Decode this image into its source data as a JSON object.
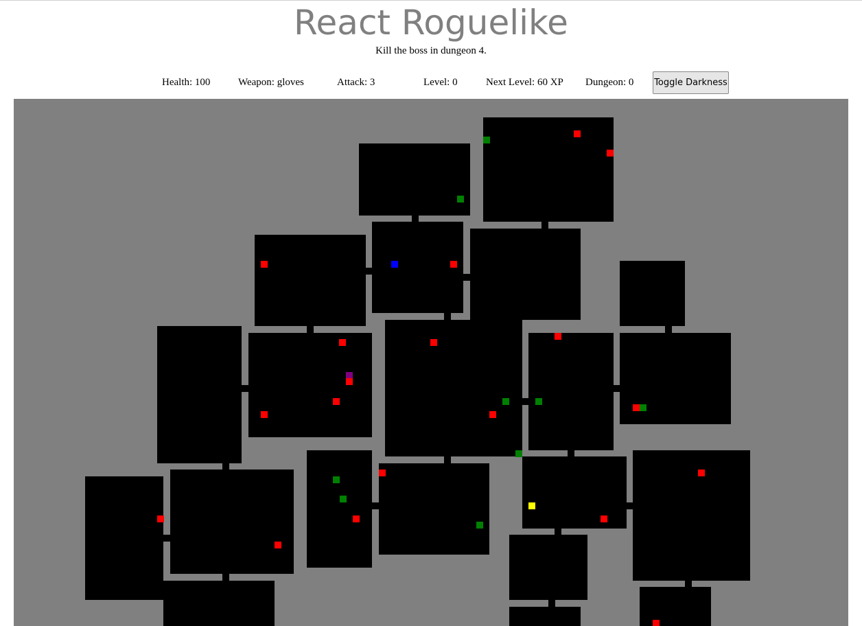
{
  "header": {
    "title": "React Roguelike",
    "subtitle": "Kill the boss in dungeon 4."
  },
  "stats": {
    "health": "Health: 100",
    "weapon": "Weapon: gloves",
    "attack": "Attack: 3",
    "level": "Level: 0",
    "next_level": "Next Level: 60 XP",
    "dungeon": "Dungeon: 0",
    "toggle_label": "Toggle Darkness"
  },
  "colors": {
    "wall": "#808080",
    "floor": "#000000",
    "player": "#0000ff",
    "enemy": "#ff0000",
    "health_item": "#008000",
    "weapon": "#ffff00",
    "stairs": "#800080"
  }
}
